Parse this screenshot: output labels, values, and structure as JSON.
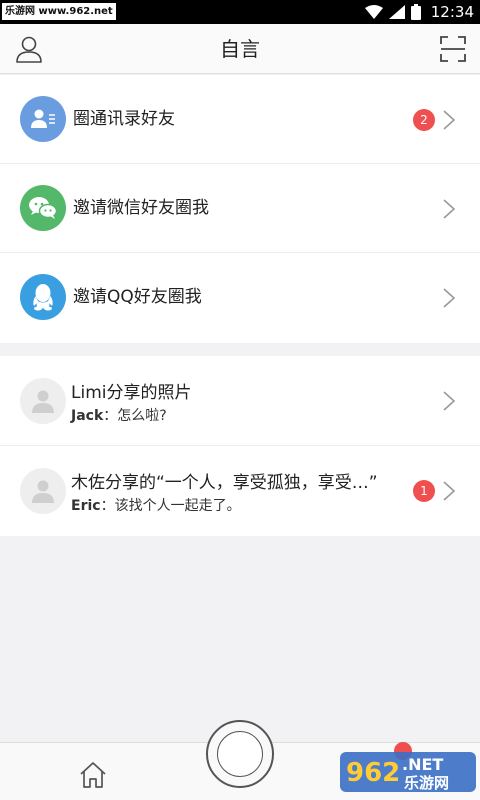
{
  "status_bar": {
    "watermark": "乐游网 www.962.net",
    "time": "12:34"
  },
  "nav": {
    "title": "自言",
    "left_icon": "user-icon",
    "right_icon": "scan-icon"
  },
  "invite_items": [
    {
      "label": "圈通讯录好友",
      "icon": "contacts-icon",
      "color": "#6a9de0",
      "badge": "2"
    },
    {
      "label": "邀请微信好友圈我",
      "icon": "wechat-icon",
      "color": "#54b86a"
    },
    {
      "label": "邀请QQ好友圈我",
      "icon": "qq-icon",
      "color": "#3a9fe0"
    }
  ],
  "messages": [
    {
      "title": "Limi分享的照片",
      "sender": "Jack",
      "text": "：怎么啦?"
    },
    {
      "title": "木佐分享的“一个人，享受孤独，享受…”",
      "sender": "Eric",
      "text": "：该找个人一起走了。",
      "badge": "1"
    }
  ],
  "tab_bar": {
    "home_icon": "home-icon",
    "camera_icon": "camera-shutter-icon"
  },
  "logo_watermark": {
    "number": "962",
    "net": ".NET",
    "name": "乐游网"
  },
  "colors": {
    "badge": "#ef4f4f",
    "background": "#f2f2f4"
  }
}
